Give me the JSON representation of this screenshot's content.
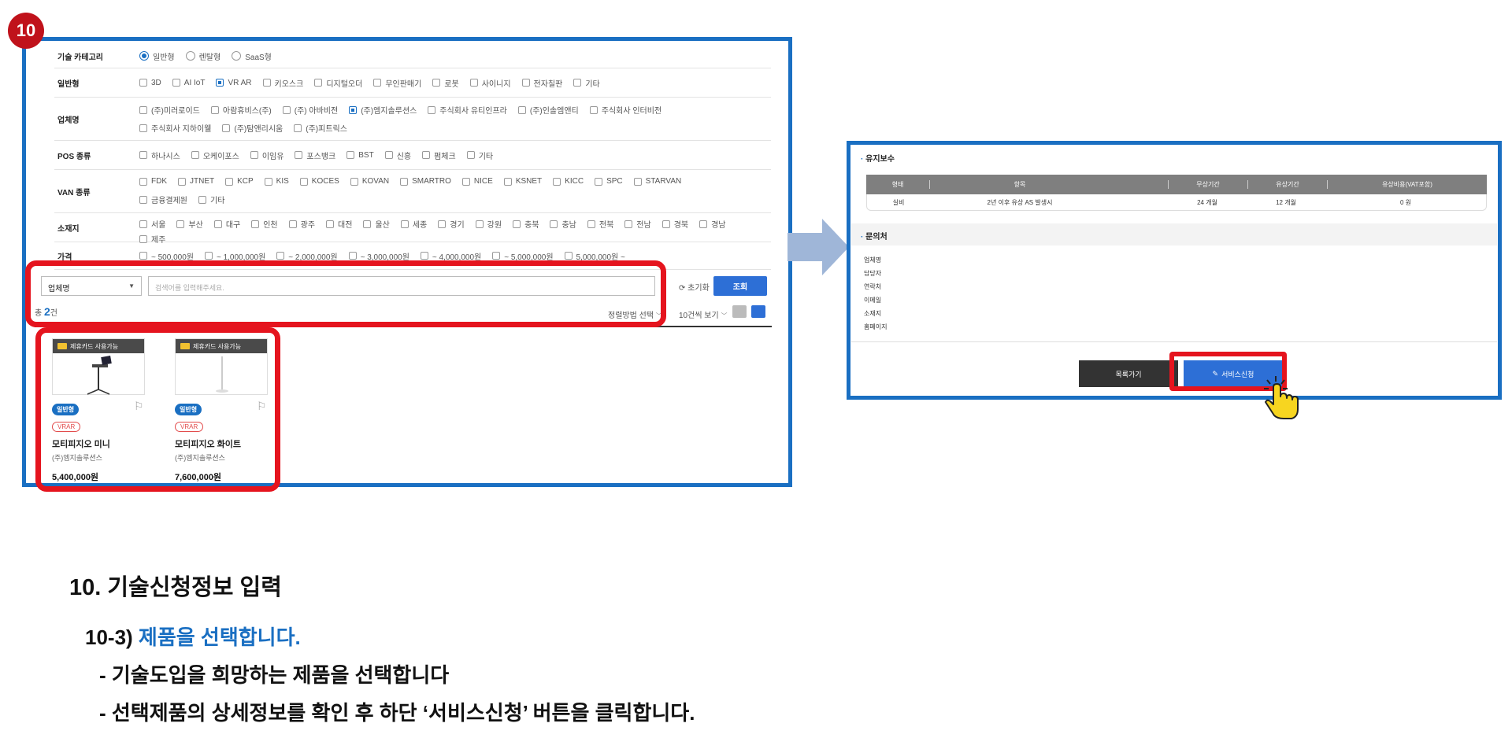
{
  "step_badge": "10",
  "filters": {
    "category": {
      "label": "기술 카테고리",
      "options": [
        {
          "text": "일반형",
          "selected": true
        },
        {
          "text": "렌탈형",
          "selected": false
        },
        {
          "text": "SaaS형",
          "selected": false
        }
      ]
    },
    "general": {
      "label": "일반형",
      "options": [
        {
          "text": "3D",
          "checked": false
        },
        {
          "text": "AI IoT",
          "checked": false
        },
        {
          "text": "VR AR",
          "checked": true
        },
        {
          "text": "키오스크",
          "checked": false
        },
        {
          "text": "디지털오더",
          "checked": false
        },
        {
          "text": "무인판매기",
          "checked": false
        },
        {
          "text": "로봇",
          "checked": false
        },
        {
          "text": "사이니지",
          "checked": false
        },
        {
          "text": "전자칠판",
          "checked": false
        },
        {
          "text": "기타",
          "checked": false
        }
      ]
    },
    "company": {
      "label": "업체명",
      "options": [
        {
          "text": "(주)미러로이드",
          "checked": false
        },
        {
          "text": "아람휴비스(주)",
          "checked": false
        },
        {
          "text": "(주) 아바비전",
          "checked": false
        },
        {
          "text": "(주)엠지솔루션스",
          "checked": true
        },
        {
          "text": "주식회사 유티인프라",
          "checked": false
        },
        {
          "text": "(주)인솔엠앤티",
          "checked": false
        },
        {
          "text": "주식회사 인터비전",
          "checked": false
        },
        {
          "text": "주식회사 지하이웰",
          "checked": false
        },
        {
          "text": "(주)탐앤리시움",
          "checked": false
        },
        {
          "text": "(주)피트릭스",
          "checked": false
        }
      ]
    },
    "pos": {
      "label": "POS 종류",
      "options": [
        {
          "text": "하나시스",
          "checked": false
        },
        {
          "text": "오케이포스",
          "checked": false
        },
        {
          "text": "이임유",
          "checked": false
        },
        {
          "text": "포스뱅크",
          "checked": false
        },
        {
          "text": "BST",
          "checked": false
        },
        {
          "text": "신흥",
          "checked": false
        },
        {
          "text": "펌체크",
          "checked": false
        },
        {
          "text": "기타",
          "checked": false
        }
      ]
    },
    "van": {
      "label": "VAN 종류",
      "options": [
        {
          "text": "FDK",
          "checked": false
        },
        {
          "text": "JTNET",
          "checked": false
        },
        {
          "text": "KCP",
          "checked": false
        },
        {
          "text": "KIS",
          "checked": false
        },
        {
          "text": "KOCES",
          "checked": false
        },
        {
          "text": "KOVAN",
          "checked": false
        },
        {
          "text": "SMARTRO",
          "checked": false
        },
        {
          "text": "NICE",
          "checked": false
        },
        {
          "text": "KSNET",
          "checked": false
        },
        {
          "text": "KICC",
          "checked": false
        },
        {
          "text": "SPC",
          "checked": false
        },
        {
          "text": "STARVAN",
          "checked": false
        },
        {
          "text": "금융결제원",
          "checked": false
        },
        {
          "text": "기타",
          "checked": false
        }
      ]
    },
    "region": {
      "label": "소재지",
      "options": [
        {
          "text": "서울",
          "checked": false
        },
        {
          "text": "부산",
          "checked": false
        },
        {
          "text": "대구",
          "checked": false
        },
        {
          "text": "인천",
          "checked": false
        },
        {
          "text": "광주",
          "checked": false
        },
        {
          "text": "대전",
          "checked": false
        },
        {
          "text": "울산",
          "checked": false
        },
        {
          "text": "세종",
          "checked": false
        },
        {
          "text": "경기",
          "checked": false
        },
        {
          "text": "강원",
          "checked": false
        },
        {
          "text": "충북",
          "checked": false
        },
        {
          "text": "충남",
          "checked": false
        },
        {
          "text": "전북",
          "checked": false
        },
        {
          "text": "전남",
          "checked": false
        },
        {
          "text": "경북",
          "checked": false
        },
        {
          "text": "경남",
          "checked": false
        },
        {
          "text": "제주",
          "checked": false
        }
      ]
    },
    "price": {
      "label": "가격",
      "options": [
        {
          "text": "~ 500,000원",
          "checked": false
        },
        {
          "text": "~ 1,000,000원",
          "checked": false
        },
        {
          "text": "~ 2,000,000원",
          "checked": false
        },
        {
          "text": "~ 3,000,000원",
          "checked": false
        },
        {
          "text": "~ 4,000,000원",
          "checked": false
        },
        {
          "text": "~ 5,000,000원",
          "checked": false
        },
        {
          "text": "5,000,000원 ~",
          "checked": false
        }
      ]
    }
  },
  "search": {
    "select_value": "업체명",
    "placeholder": "검색어를 입력해주세요.",
    "reset_label": "초기화",
    "search_label": "조회"
  },
  "results": {
    "total_prefix": "총",
    "total_count": "2",
    "total_suffix": "건",
    "sort_label": "정렬방법 선택",
    "per_page_label": "10건씩 보기"
  },
  "products": [
    {
      "tag": "제휴카드 사용가능",
      "type": "일반형",
      "category": "VRAR",
      "name": "모티피지오 미니",
      "company": "(주)엠지솔루션스",
      "price": "5,400,000원"
    },
    {
      "tag": "제휴카드 사용가능",
      "type": "일반형",
      "category": "VRAR",
      "name": "모티피지오 화이트",
      "company": "(주)엠지솔루션스",
      "price": "7,600,000원"
    }
  ],
  "detail": {
    "maintenance_title": "유지보수",
    "table_headers": [
      "형태",
      "항목",
      "무상기간",
      "유상기간",
      "유상비용(VAT포함)"
    ],
    "table_row": [
      "실비",
      "2년 이후 유상 AS 발생시",
      "24 개월",
      "12 개월",
      "0 원"
    ],
    "contact_title": "문의처",
    "contact_fields": [
      "업체명",
      "담당자",
      "연락처",
      "이메일",
      "소재지",
      "홈페이지"
    ],
    "list_button": "목록가기",
    "apply_button": "서비스신청"
  },
  "caption": {
    "heading": "10. 기술신청정보 입력",
    "sub_prefix": "10-3) ",
    "sub_highlight": "제품을 선택합니다.",
    "bullet1": "- 기술도입을 희망하는 제품을 선택합니다",
    "bullet2": "- 선택제품의 상세정보를 확인 후  하단 ‘서비스신청’ 버튼을 클릭합니다."
  },
  "colors": {
    "frame_blue": "#1a6fc2",
    "highlight_red": "#e5141e",
    "button_blue": "#2d6fd6",
    "badge_red": "#c0121b"
  }
}
